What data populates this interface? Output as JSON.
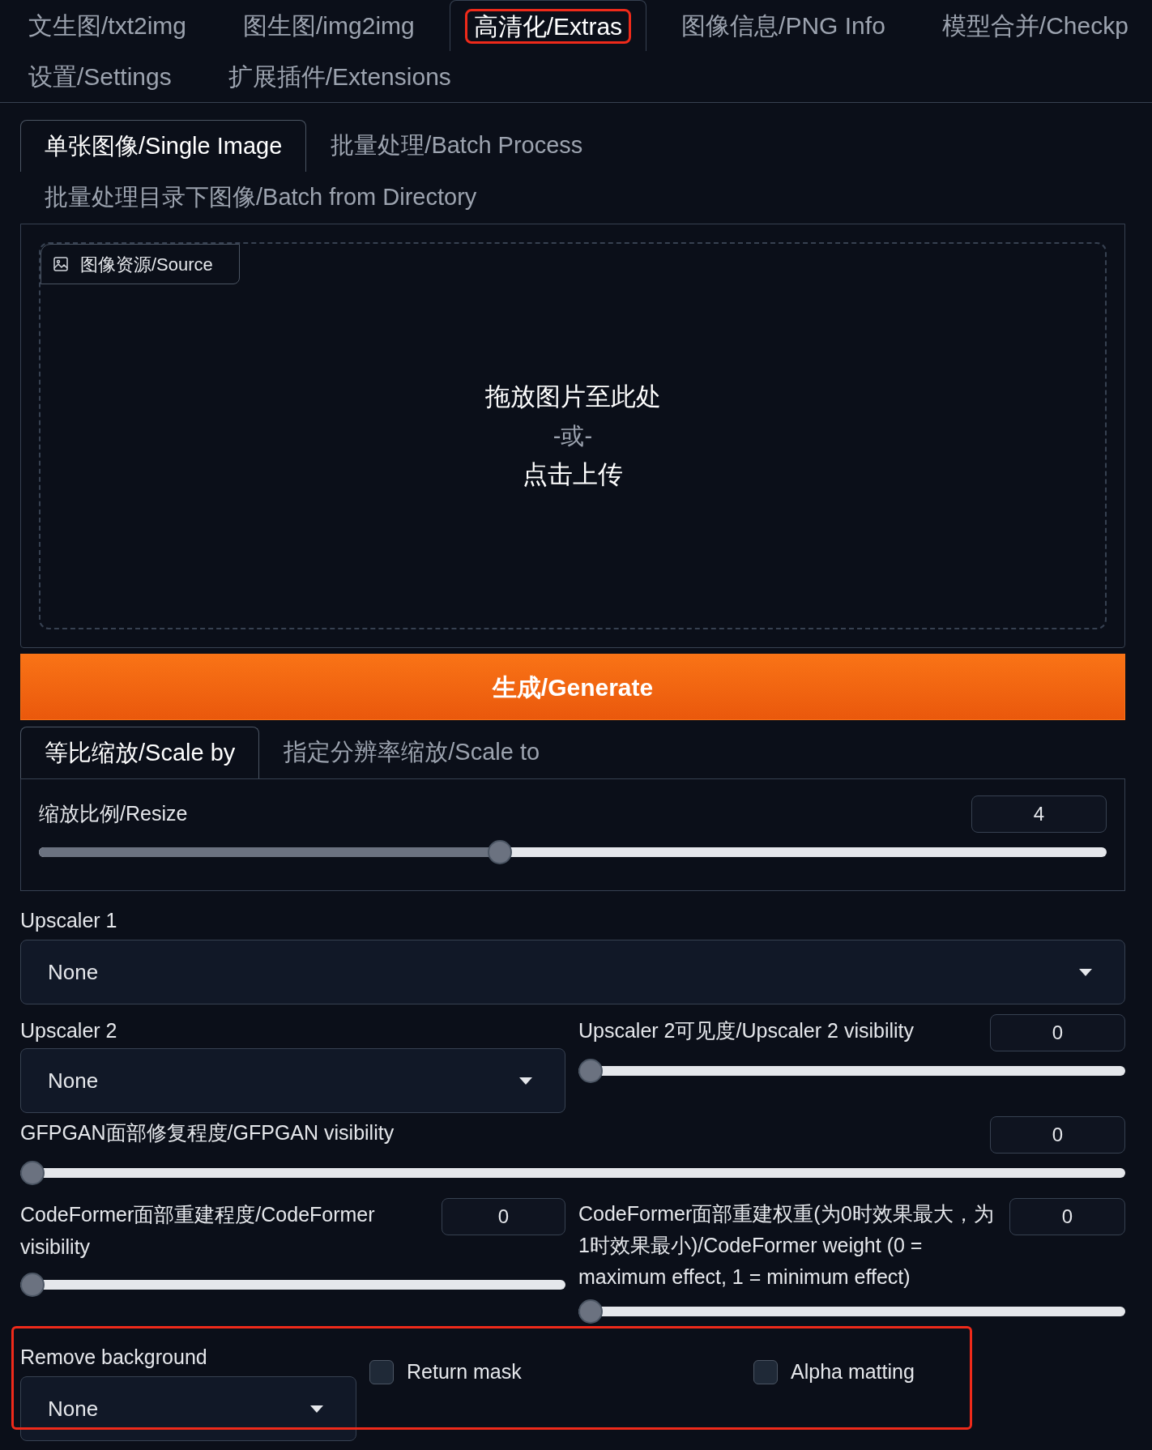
{
  "top_tabs": [
    {
      "label": "文生图/txt2img",
      "selected": false,
      "highlighted": false
    },
    {
      "label": "图生图/img2img",
      "selected": false,
      "highlighted": false
    },
    {
      "label": "高清化/Extras",
      "selected": true,
      "highlighted": true
    },
    {
      "label": "图像信息/PNG Info",
      "selected": false,
      "highlighted": false
    },
    {
      "label": "模型合并/Checkp",
      "selected": false,
      "highlighted": false
    },
    {
      "label": "设置/Settings",
      "selected": false,
      "highlighted": false
    },
    {
      "label": "扩展插件/Extensions",
      "selected": false,
      "highlighted": false
    }
  ],
  "sub_tabs": [
    {
      "label": "单张图像/Single Image",
      "selected": true
    },
    {
      "label": "批量处理/Batch Process",
      "selected": false
    },
    {
      "label": "批量处理目录下图像/Batch from Directory",
      "selected": false
    }
  ],
  "source": {
    "label": "图像资源/Source",
    "drop_text": "拖放图片至此处",
    "or_text": "-或-",
    "click_text": "点击上传"
  },
  "generate_button": "生成/Generate",
  "scale_tabs": [
    {
      "label": "等比缩放/Scale by",
      "selected": true
    },
    {
      "label": "指定分辨率缩放/Scale to",
      "selected": false
    }
  ],
  "resize": {
    "label": "缩放比例/Resize",
    "value": "4",
    "level": 0.43
  },
  "upscaler1": {
    "label": "Upscaler 1",
    "value": "None"
  },
  "upscaler2": {
    "label": "Upscaler 2",
    "value": "None"
  },
  "upscaler2_visibility": {
    "label": "Upscaler 2可见度/Upscaler 2 visibility",
    "value": "0",
    "level": 0
  },
  "gfpgan_visibility": {
    "label": "GFPGAN面部修复程度/GFPGAN visibility",
    "value": "0",
    "level": 0
  },
  "codeformer_visibility": {
    "label": "CodeFormer面部重建程度/CodeFormer visibility",
    "value": "0",
    "level": 0
  },
  "codeformer_weight": {
    "label": "CodeFormer面部重建权重(为0时效果最大，为1时效果最小)/CodeFormer weight (0 = maximum effect, 1 = minimum effect)",
    "value": "0",
    "level": 0
  },
  "remove_background": {
    "label": "Remove background",
    "value": "None",
    "highlighted": true
  },
  "checkboxes": [
    {
      "label": "Return mask",
      "checked": false
    },
    {
      "label": "Alpha matting",
      "checked": false
    }
  ]
}
